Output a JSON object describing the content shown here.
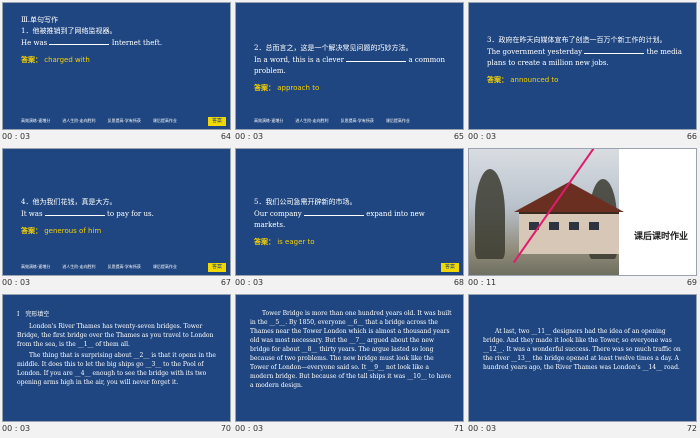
{
  "nav": {
    "items": [
      "高效演练·速增分",
      "进人生阶·走向胜利",
      "反思提高·学有所获",
      "课后提高作业"
    ],
    "answer_btn": "答案",
    "answer_label": "答案："
  },
  "slides": [
    {
      "time": "00 : 03",
      "number": "64",
      "section": "Ⅲ.单句写作",
      "line_cn": "1．他被推销到了网络监视器。",
      "line_en_pre": "He was",
      "line_en_post": "Internet theft.",
      "answer": "charged with"
    },
    {
      "time": "00 : 03",
      "number": "65",
      "line_cn": "2．总而言之，这是一个解决常见问题的巧妙方法。",
      "line_en_pre": "In a word, this is a clever",
      "line_en_post": "a common problem.",
      "answer": "approach to"
    },
    {
      "time": "00 : 03",
      "number": "66",
      "line_cn": "3．政府在昨天向媒体宣布了创造一百万个新工作的计划。",
      "line_en_pre": "The government yesterday",
      "line_en_post": "the media plans to create a million new jobs.",
      "answer": "announced to"
    },
    {
      "time": "00 : 03",
      "number": "67",
      "line_cn": "4．他为我们花钱，真是大方。",
      "line_en_pre": "It was",
      "line_en_post": "to pay for us.",
      "answer": "generous of him"
    },
    {
      "time": "00 : 03",
      "number": "68",
      "line_cn": "5．我们公司急需开辟新的市场。",
      "line_en_pre": "Our company",
      "line_en_post": "expand into new markets.",
      "answer": "is eager to"
    },
    {
      "time": "00 : 11",
      "number": "69",
      "title": "课后课时作业"
    },
    {
      "time": "00 : 03",
      "number": "70",
      "section": "Ⅰ　完形填空",
      "paras": [
        "London's River Thames has twenty-seven bridges. Tower Bridge, the first bridge over the Thames as you travel to London from the sea, is the __1__ of them all.",
        "The thing that is surprising about __2__ is that it opens in the middle. It does this to let the big ships go __3__ to the Pool of London. If you are __4__ enough to see the bridge with its two opening arms high in the air, you will never forget it."
      ]
    },
    {
      "time": "00 : 03",
      "number": "71",
      "paras": [
        "Tower Bridge is more than one hundred years old. It was built in the __5__. By 1850, everyone __6__ that a bridge across the Thames near the Tower London which is almost a thousand years old was most necessary. But the __7__ argued about the new bridge for about __8__ thirty years. The argue lasted so long because of two problems. The new bridge must look like the Tower of London—everyone said so. It __9__ not look like a modern bridge. But because of the tall ships it was __10__ to have a modern design."
      ]
    },
    {
      "time": "00 : 03",
      "number": "72",
      "paras": [
        "At last, two __11__ designers had the idea of an opening bridge. And they made it look like the Tower, so everyone was __12__. It was a wonderful success. There was so much traffic on the river __13__ the bridge opened at least twelve times a day. A hundred years ago, the River Thames was London's __14__ road."
      ]
    }
  ]
}
